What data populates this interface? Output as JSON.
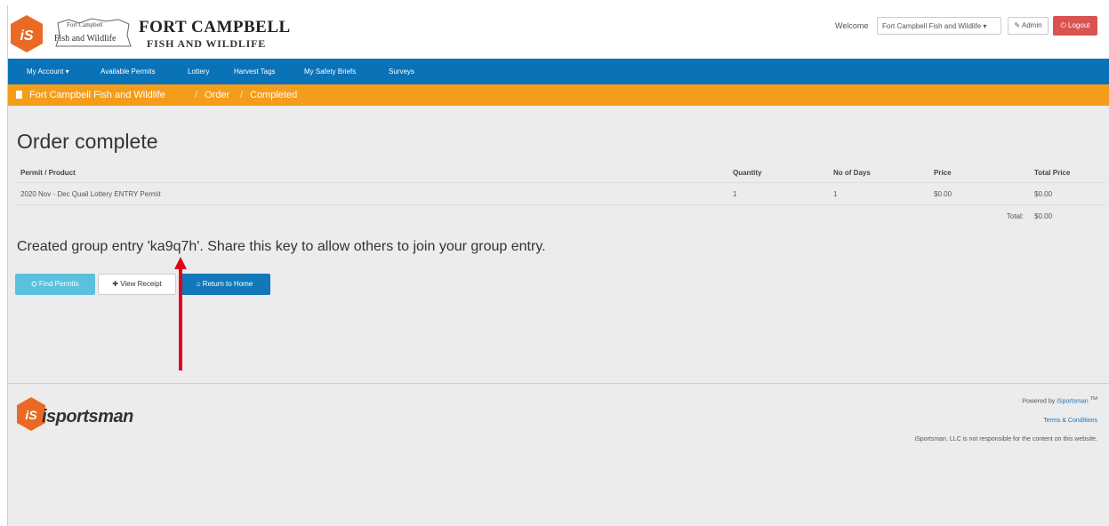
{
  "header": {
    "brand_title": "FORT CAMPBELL",
    "brand_subtitle": "FISH AND WILDLIFE",
    "logo_text_top": "Fort Campbell",
    "logo_text_bottom": "Fish and Wildlife",
    "welcome_label": "Welcome",
    "account_select": "Fort Campbell Fish and Wildlife ▾",
    "admin_label": "✎ Admin",
    "logout_label": "⏻ Logout"
  },
  "nav": {
    "items": [
      {
        "label": "My Account ▾"
      },
      {
        "label": "Available Permits"
      },
      {
        "label": "Lottery"
      },
      {
        "label": "Harvest Tags"
      },
      {
        "label": "My Safety Briefs"
      },
      {
        "label": "Surveys"
      }
    ]
  },
  "breadcrumb": [
    "Fort Campbell Fish and Wildlife",
    "Order",
    "Completed"
  ],
  "main": {
    "title": "Order complete",
    "table": {
      "headers": [
        "Permit / Product",
        "Quantity",
        "No of Days",
        "Price",
        "Total Price"
      ],
      "rows": [
        [
          "2020 Nov - Dec Quail Lottery ENTRY Permit",
          "1",
          "1",
          "$0.00",
          "$0.00"
        ]
      ],
      "total_label": "Total:",
      "total_value": "$0.00"
    },
    "group_message": "Created group entry 'ka9q7h'. Share this key to allow others to join your group entry.",
    "buttons": {
      "find_permits": "⛭ Find Permits",
      "view_receipt": "✚ View Receipt",
      "return_home": "⌂ Return to Home"
    }
  },
  "footer": {
    "logo_word": "isportsman",
    "powered_by": "Powered by",
    "powered_link": "iSportsman",
    "tm": "TM",
    "terms": "Terms & Conditions",
    "disclaimer": "iSportsman, LLC is not responsible for the content on this website."
  },
  "colors": {
    "nav_blue": "#0a72b7",
    "breadcrumb_orange": "#f59c1a",
    "logout_red": "#d9534f",
    "find_permits_cyan": "#5bc0de",
    "brand_orange": "#ea6a25",
    "annotation_red": "#e0001a"
  }
}
